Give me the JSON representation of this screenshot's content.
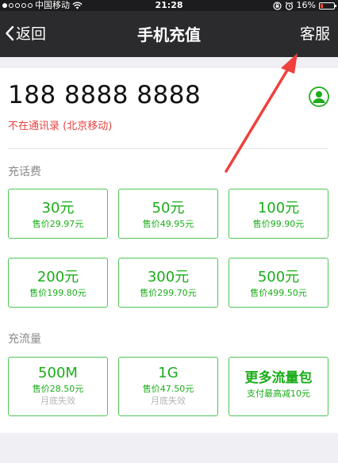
{
  "status_bar": {
    "carrier": "中国移动",
    "time": "21:28",
    "battery": "16%",
    "battery_level": 0.16,
    "signal_dots_filled": 1,
    "signal_dots_total": 5,
    "icons": [
      "wifi-icon",
      "rotation-lock-icon",
      "alarm-icon",
      "battery-icon"
    ]
  },
  "nav": {
    "back_label": "返回",
    "title": "手机充值",
    "service_label": "客服"
  },
  "account": {
    "phone_number": "188 8888 8888",
    "contact_status": "不在通讯录 (北京移动)"
  },
  "credit": {
    "label": "充话费",
    "tiles": [
      {
        "amount": "30元",
        "price": "售价29.97元"
      },
      {
        "amount": "50元",
        "price": "售价49.95元"
      },
      {
        "amount": "100元",
        "price": "售价99.90元"
      },
      {
        "amount": "200元",
        "price": "售价199.80元"
      },
      {
        "amount": "300元",
        "price": "售价299.70元"
      },
      {
        "amount": "500元",
        "price": "售价499.50元"
      }
    ]
  },
  "data_plan": {
    "label": "充流量",
    "tiles": [
      {
        "amount": "500M",
        "price": "售价28.50元",
        "note": "月底失效"
      },
      {
        "amount": "1G",
        "price": "售价47.50元",
        "note": "月底失效"
      },
      {
        "amount": "更多流量包",
        "price": "支付最高减10元"
      }
    ]
  },
  "colors": {
    "accent_green": "#1aad19",
    "tile_border": "#4fc455",
    "warning_red": "#e64340",
    "nav_background": "#2b2b2d",
    "annotation_arrow": "#f0403c"
  }
}
